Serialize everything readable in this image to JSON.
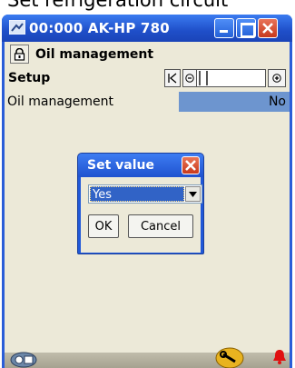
{
  "caption": "Set refrigeration circuit",
  "window": {
    "title": "00:000 AK-HP 780",
    "buttons": [
      "minimize",
      "maximize",
      "close"
    ]
  },
  "header": {
    "title": "Oil management",
    "icon": "lock-icon"
  },
  "setup": {
    "label": "Setup",
    "pager_icons": [
      "first-page-icon",
      "prev-icon",
      "next-icon"
    ]
  },
  "param": {
    "label": "Oil management",
    "value": "No"
  },
  "dialog": {
    "title": "Set value",
    "selected": "Yes",
    "ok_label": "OK",
    "cancel_label": "Cancel"
  },
  "colors": {
    "title_blue": "#2058d8",
    "value_highlight": "#6d95cf",
    "client_bg": "#ece9d8",
    "close_red": "#c8391c"
  }
}
